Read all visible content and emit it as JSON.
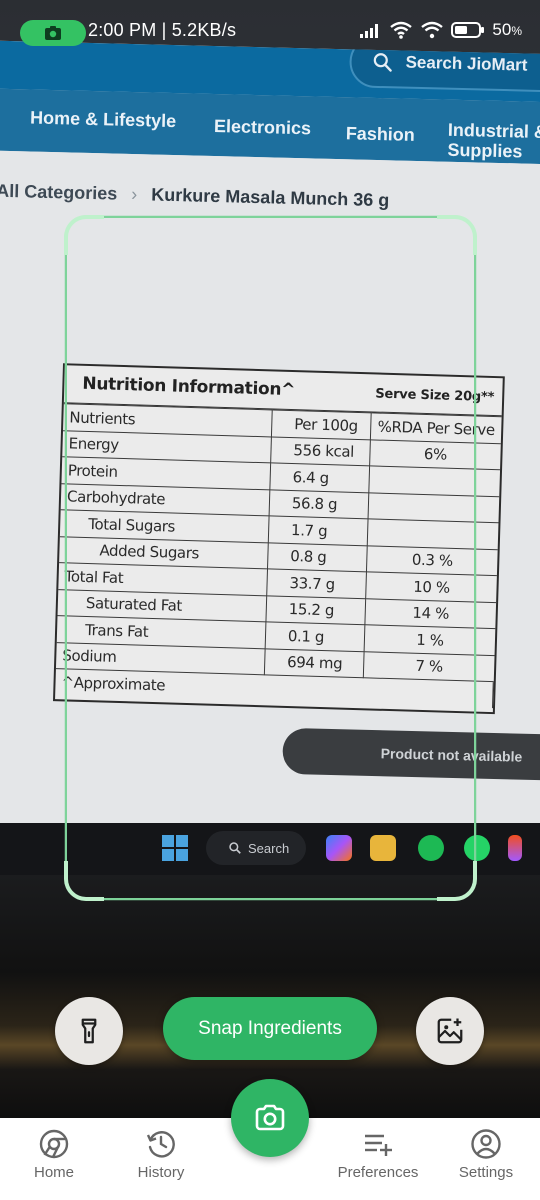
{
  "status_bar": {
    "time_speed": "2:00 PM | 5.2KB/s",
    "battery_value": "50",
    "battery_unit": "%"
  },
  "background_site": {
    "search_text": "Search JioMart",
    "nav": [
      "Home & Lifestyle",
      "Electronics",
      "Fashion",
      "Industrial & Supplies"
    ],
    "breadcrumb": [
      "All Categories",
      "Kurkure Masala Munch 36 g"
    ],
    "availability_text": "Product not available",
    "taskbar_search": "Search"
  },
  "nutrition_label": {
    "title": "Nutrition Information^",
    "serve_size": "Serve Size 20g**",
    "columns": [
      "Nutrients",
      "Per 100g",
      "%RDA Per Serve"
    ],
    "rows": [
      {
        "nutrient": "Energy",
        "per100": "556 kcal",
        "rda": "6%",
        "indent": 0
      },
      {
        "nutrient": "Protein",
        "per100": "6.4 g",
        "rda": "",
        "indent": 0
      },
      {
        "nutrient": "Carbohydrate",
        "per100": "56.8 g",
        "rda": "",
        "indent": 0
      },
      {
        "nutrient": "Total Sugars",
        "per100": "1.7 g",
        "rda": "",
        "indent": 1
      },
      {
        "nutrient": "Added Sugars",
        "per100": "0.8 g",
        "rda": "0.3 %",
        "indent": 2
      },
      {
        "nutrient": "Total Fat",
        "per100": "33.7 g",
        "rda": "10 %",
        "indent": 0
      },
      {
        "nutrient": "Saturated Fat",
        "per100": "15.2 g",
        "rda": "14 %",
        "indent": 1
      },
      {
        "nutrient": "Trans Fat",
        "per100": "0.1 g",
        "rda": "1 %",
        "indent": 1
      },
      {
        "nutrient": "Sodium",
        "per100": "694 mg",
        "rda": "7 %",
        "indent": 0
      }
    ],
    "footnote": "^Approximate"
  },
  "controls": {
    "snap_label": "Snap Ingredients",
    "torch_icon": "flashlight-icon",
    "gallery_icon": "add-image-icon"
  },
  "bottom_nav": {
    "home": "Home",
    "history": "History",
    "preferences": "Preferences",
    "settings": "Settings"
  },
  "colors": {
    "accent": "#2fb565",
    "scan_frame": "#7ed39a"
  }
}
